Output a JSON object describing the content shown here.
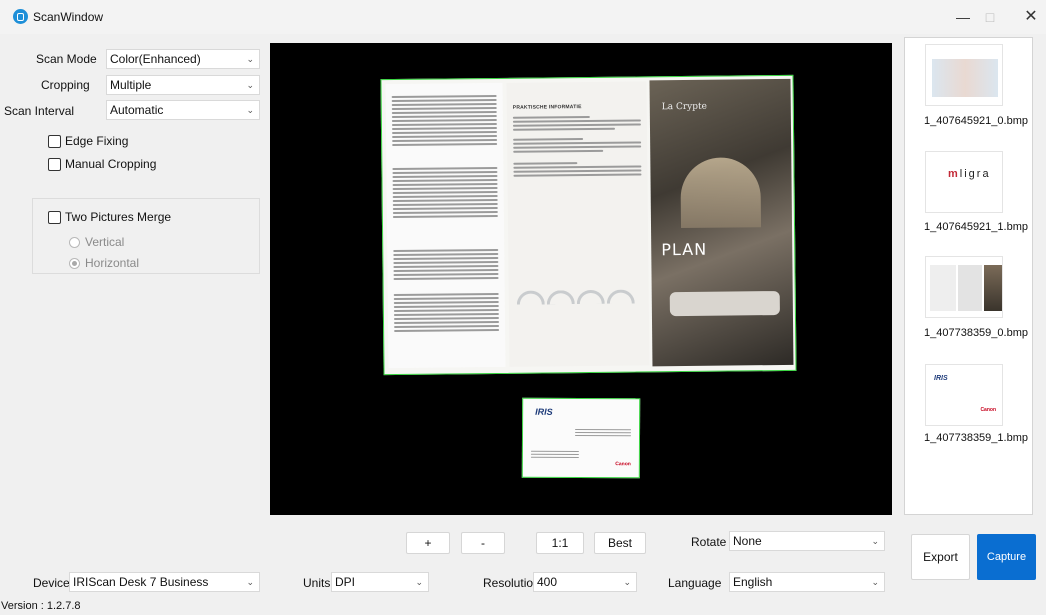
{
  "window": {
    "title": "ScanWindow",
    "minimize_glyph": "—",
    "maximize_glyph": "□",
    "close_glyph": "✕"
  },
  "settings": {
    "scan_mode": {
      "label": "Scan Mode",
      "value": "Color(Enhanced)"
    },
    "cropping": {
      "label": "Cropping",
      "value": "Multiple"
    },
    "scan_interval": {
      "label": "Scan Interval",
      "value": "Automatic"
    },
    "edge_fixing": {
      "label": "Edge Fixing",
      "checked": false
    },
    "manual_cropping": {
      "label": "Manual Cropping",
      "checked": false
    },
    "two_pictures_merge": {
      "label": "Two Pictures Merge",
      "checked": false
    },
    "merge_vertical": {
      "label": "Vertical",
      "checked": false
    },
    "merge_horizontal": {
      "label": "Horizontal",
      "checked": true
    }
  },
  "preview": {
    "doc_heading": "PRAKTISCHE INFORMATIE",
    "doc_brand": "La Crypte",
    "doc_plan": "PLAN",
    "card_logo": "IRIS",
    "card_brand": "Canon"
  },
  "thumbnails": [
    {
      "filename": "1_407645921_0.bmp",
      "icon": "floorplan-thumbnail"
    },
    {
      "filename": "1_407645921_1.bmp",
      "icon": "ligra-card-thumbnail",
      "text": "ligra"
    },
    {
      "filename": "1_407738359_0.bmp",
      "icon": "brochure-thumbnail"
    },
    {
      "filename": "1_407738359_1.bmp",
      "icon": "iris-card-thumbnail",
      "text": "IRIS"
    }
  ],
  "zoom_controls": {
    "zoom_in": "+",
    "zoom_out": "-",
    "actual_size": "1:1",
    "best_fit": "Best"
  },
  "rotate": {
    "label": "Rotate",
    "value": "None"
  },
  "device": {
    "label": "Device",
    "value": "IRIScan Desk 7 Business"
  },
  "units": {
    "label": "Units",
    "value": "DPI"
  },
  "resolution": {
    "label": "Resolution",
    "value": "400"
  },
  "language": {
    "label": "Language",
    "value": "English"
  },
  "actions": {
    "export": "Export",
    "capture": "Capture"
  },
  "status": {
    "version": "Version : 1.2.7.8"
  },
  "colors": {
    "accent": "#0a6ed1",
    "crop_border": "#38d440"
  }
}
